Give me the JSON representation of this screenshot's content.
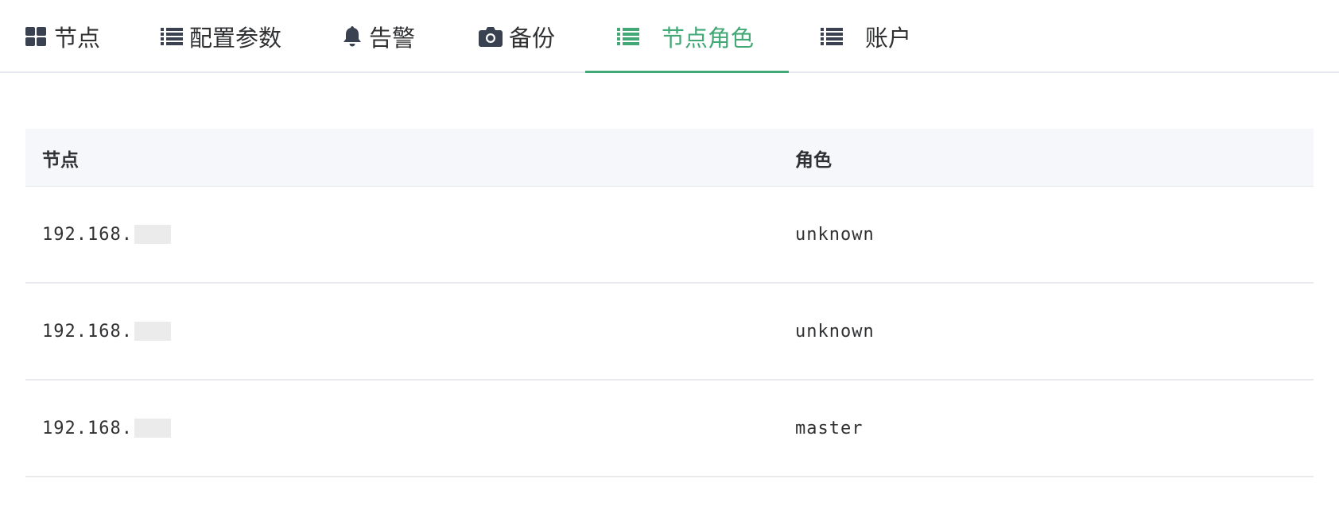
{
  "tabs": [
    {
      "label": "节点",
      "icon": "grid-icon"
    },
    {
      "label": "配置参数",
      "icon": "list-icon"
    },
    {
      "label": "告警",
      "icon": "bell-icon"
    },
    {
      "label": "备份",
      "icon": "camera-icon"
    },
    {
      "label": "节点角色",
      "icon": "list-icon",
      "active": true
    },
    {
      "label": "账户",
      "icon": "list-icon"
    }
  ],
  "colors": {
    "accent": "#42a876",
    "text": "#303133",
    "header_bg": "#f5f7fa"
  },
  "table": {
    "headers": {
      "node": "节点",
      "role": "角色"
    },
    "rows": [
      {
        "node": "192.168.",
        "role": "unknown"
      },
      {
        "node": "192.168.",
        "role": "unknown"
      },
      {
        "node": "192.168.",
        "role": "master"
      }
    ]
  }
}
